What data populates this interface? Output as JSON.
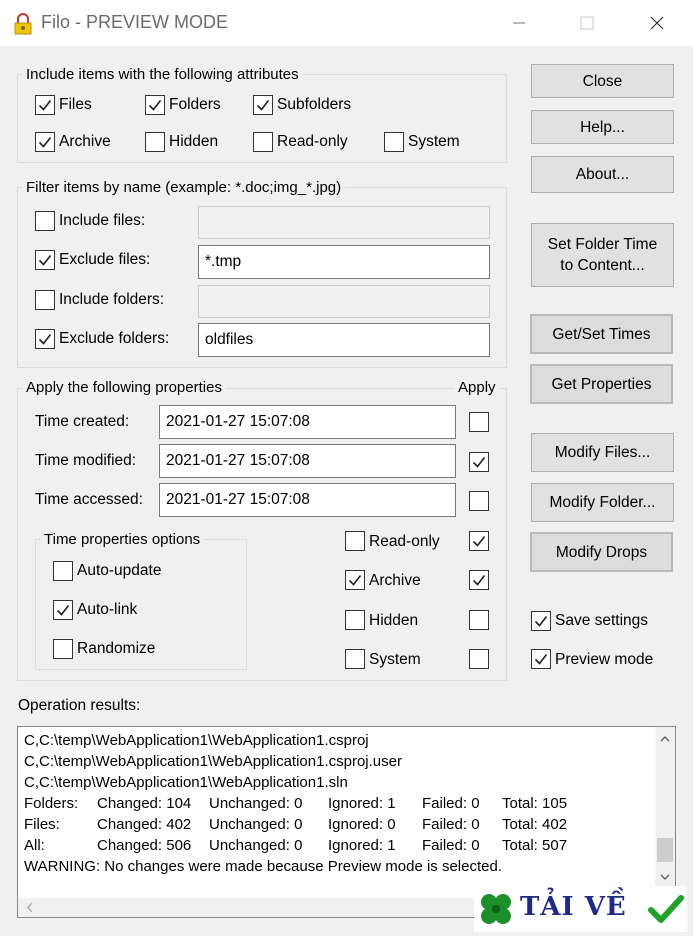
{
  "window": {
    "title": "Filo - PREVIEW MODE",
    "icon": "filo-lock-icon",
    "controls": [
      "minimize-icon",
      "maximize-icon",
      "close-icon"
    ]
  },
  "attributes": {
    "label": "Include items with the following attributes",
    "items": [
      {
        "label": "Files",
        "checked": true
      },
      {
        "label": "Folders",
        "checked": true
      },
      {
        "label": "Subfolders",
        "checked": true
      },
      {
        "label": "Archive",
        "checked": true
      },
      {
        "label": "Hidden",
        "checked": false
      },
      {
        "label": "Read-only",
        "checked": false
      },
      {
        "label": "System",
        "checked": false
      }
    ]
  },
  "filter": {
    "label": "Filter items by name (example: *.doc;img_*.jpg)",
    "rows": [
      {
        "label": "Include files:",
        "checked": false,
        "value": "",
        "enabled": false
      },
      {
        "label": "Exclude files:",
        "checked": true,
        "value": "*.tmp",
        "enabled": true
      },
      {
        "label": "Include folders:",
        "checked": false,
        "value": "",
        "enabled": false
      },
      {
        "label": "Exclude folders:",
        "checked": true,
        "value": "oldfiles",
        "enabled": true
      }
    ]
  },
  "properties": {
    "label": "Apply the following properties",
    "apply_label": "Apply",
    "times": [
      {
        "label": "Time created:",
        "value": "2021-01-27 15:07:08",
        "apply": false
      },
      {
        "label": "Time modified:",
        "value": "2021-01-27 15:07:08",
        "apply": true
      },
      {
        "label": "Time accessed:",
        "value": "2021-01-27 15:07:08",
        "apply": false
      }
    ],
    "time_options": {
      "label": "Time properties options",
      "items": [
        {
          "label": "Auto-update",
          "checked": false
        },
        {
          "label": "Auto-link",
          "checked": true
        },
        {
          "label": "Randomize",
          "checked": false
        }
      ]
    },
    "attrs": [
      {
        "label": "Read-only",
        "checked": false,
        "apply": true
      },
      {
        "label": "Archive",
        "checked": true,
        "apply": true
      },
      {
        "label": "Hidden",
        "checked": false,
        "apply": false
      },
      {
        "label": "System",
        "checked": false,
        "apply": false
      }
    ]
  },
  "buttons": {
    "close": "Close",
    "help": "Help...",
    "about": "About...",
    "set_folder_time_line1": "Set Folder Time",
    "set_folder_time_line2": "to Content...",
    "get_set_times": "Get/Set Times",
    "get_properties": "Get Properties",
    "modify_files": "Modify Files...",
    "modify_folder": "Modify Folder...",
    "modify_drops": "Modify Drops"
  },
  "options": {
    "save_settings": {
      "label": "Save settings",
      "checked": true
    },
    "preview_mode": {
      "label": "Preview mode",
      "checked": true
    }
  },
  "results": {
    "label": "Operation results:",
    "lines": [
      "C,C:\\temp\\WebApplication1\\WebApplication1.csproj",
      "C,C:\\temp\\WebApplication1\\WebApplication1.csproj.user",
      "C,C:\\temp\\WebApplication1\\WebApplication1.sln"
    ],
    "stats": [
      {
        "c0": "Folders:",
        "c1": "Changed: 104",
        "c2": "Unchanged: 0",
        "c3": "Ignored: 1",
        "c4": "Failed: 0",
        "c5": "Total: 105"
      },
      {
        "c0": "Files:",
        "c1": "Changed: 402",
        "c2": "Unchanged: 0",
        "c3": "Ignored: 0",
        "c4": "Failed: 0",
        "c5": "Total: 402"
      },
      {
        "c0": "All:",
        "c1": "Changed: 506",
        "c2": "Unchanged: 0",
        "c3": "Ignored: 1",
        "c4": "Failed: 0",
        "c5": "Total: 507"
      }
    ],
    "warning": "WARNING: No changes were made because Preview mode is selected."
  },
  "watermark": {
    "text": "TẢI VỀ",
    "icons": [
      "clover-icon",
      "checkmark-icon"
    ],
    "colors": {
      "text": "#1e2a8a",
      "clover": "#1a8f2a",
      "check": "#1fa12a"
    }
  }
}
